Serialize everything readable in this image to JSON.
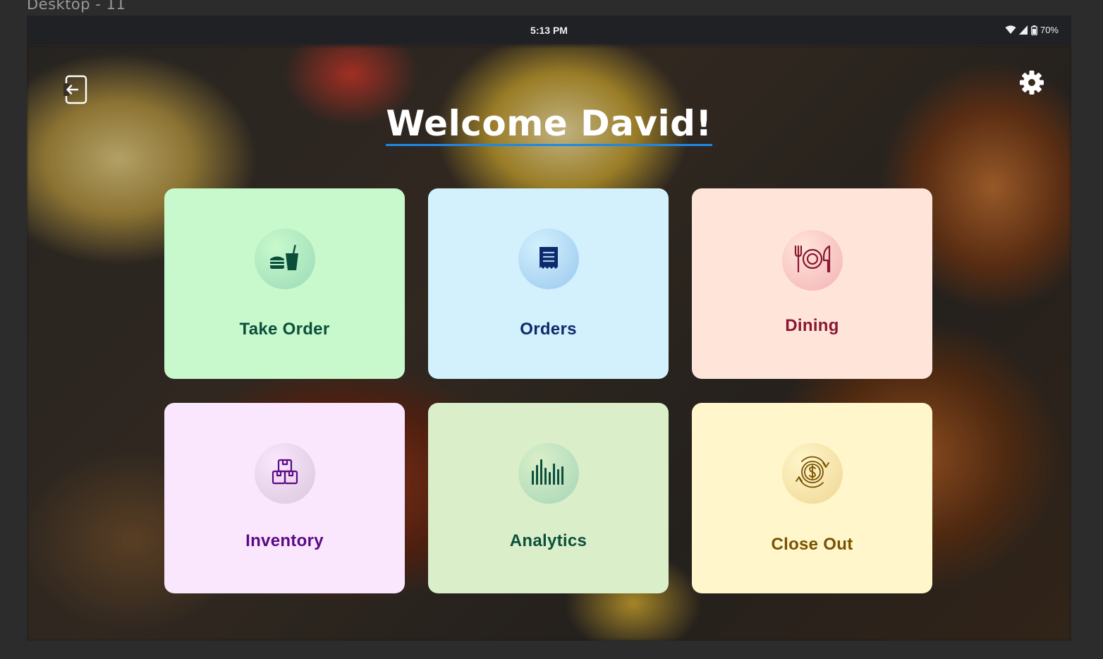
{
  "frame_label": "Desktop - 11",
  "status_bar": {
    "time": "5:13 PM",
    "battery": "70%"
  },
  "welcome_text": "Welcome David!",
  "tiles": [
    {
      "label": "Take Order",
      "bg": "#c8f9cc",
      "circle": "#a6e2bd",
      "color": "#0b4f3b",
      "icon": "fast-food-icon"
    },
    {
      "label": "Orders",
      "bg": "#d2f1fd",
      "circle": "#a8d2f2",
      "color": "#0e2a6b",
      "icon": "receipt-icon"
    },
    {
      "label": "Dining",
      "bg": "#ffe5d9",
      "circle": "#f6bfbf",
      "color": "#8a1631",
      "icon": "plate-cutlery-icon"
    },
    {
      "label": "Inventory",
      "bg": "#fae6fd",
      "circle": "#e2cfe4",
      "color": "#5a0a86",
      "icon": "boxes-icon"
    },
    {
      "label": "Analytics",
      "bg": "#daefc9",
      "circle": "#b3dcbc",
      "color": "#0b4f3b",
      "icon": "bar-chart-icon"
    },
    {
      "label": "Close Out",
      "bg": "#fff6cb",
      "circle": "#f3dea0",
      "color": "#7a5200",
      "icon": "cash-cycle-icon"
    }
  ]
}
